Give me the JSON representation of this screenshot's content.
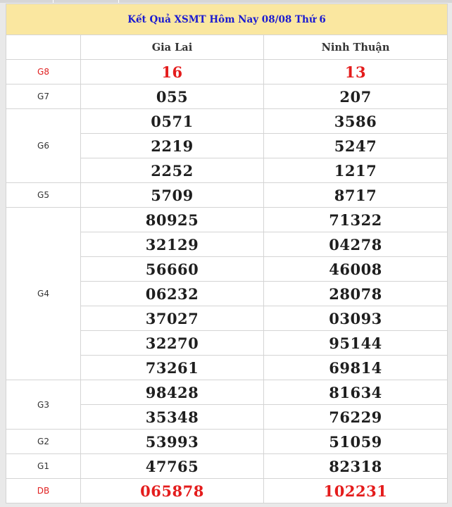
{
  "title": "Kết Quả XSMT Hôm Nay 08/08 Thứ 6",
  "provinces": [
    "Gia Lai",
    "Ninh Thuận"
  ],
  "prizes": [
    {
      "label": "G8",
      "highlight": true,
      "rows": [
        [
          "16",
          "13"
        ]
      ]
    },
    {
      "label": "G7",
      "highlight": false,
      "rows": [
        [
          "055",
          "207"
        ]
      ]
    },
    {
      "label": "G6",
      "highlight": false,
      "rows": [
        [
          "0571",
          "3586"
        ],
        [
          "2219",
          "5247"
        ],
        [
          "2252",
          "1217"
        ]
      ]
    },
    {
      "label": "G5",
      "highlight": false,
      "rows": [
        [
          "5709",
          "8717"
        ]
      ]
    },
    {
      "label": "G4",
      "highlight": false,
      "rows": [
        [
          "80925",
          "71322"
        ],
        [
          "32129",
          "04278"
        ],
        [
          "56660",
          "46008"
        ],
        [
          "06232",
          "28078"
        ],
        [
          "37027",
          "03093"
        ],
        [
          "32270",
          "95144"
        ],
        [
          "73261",
          "69814"
        ]
      ]
    },
    {
      "label": "G3",
      "highlight": false,
      "rows": [
        [
          "98428",
          "81634"
        ],
        [
          "35348",
          "76229"
        ]
      ]
    },
    {
      "label": "G2",
      "highlight": false,
      "rows": [
        [
          "53993",
          "51059"
        ]
      ]
    },
    {
      "label": "G1",
      "highlight": false,
      "rows": [
        [
          "47765",
          "82318"
        ]
      ]
    },
    {
      "label": "DB",
      "highlight": true,
      "rows": [
        [
          "065878",
          "102231"
        ]
      ]
    }
  ],
  "colors": {
    "title_bg": "#fae7a0",
    "title_text": "#1a1ad1",
    "highlight": "#e41c1c",
    "border": "#d4d4d4"
  }
}
